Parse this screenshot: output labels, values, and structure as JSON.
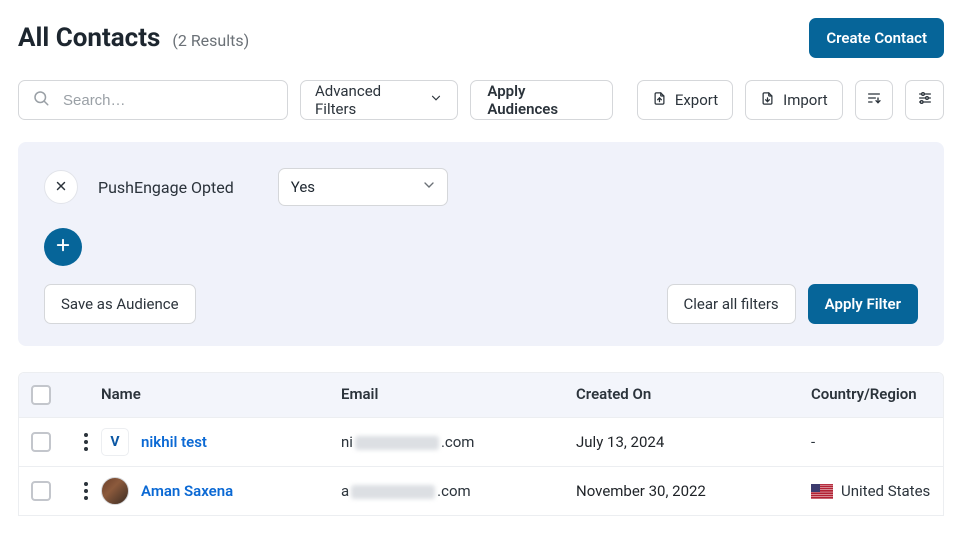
{
  "header": {
    "title": "All Contacts",
    "results_label": "(2 Results)",
    "create_button": "Create Contact"
  },
  "toolbar": {
    "search_placeholder": "Search…",
    "advanced_filters": "Advanced Filters",
    "apply_audiences": "Apply Audiences",
    "export": "Export",
    "import": "Import"
  },
  "filter_panel": {
    "field_label": "PushEngage Opted",
    "value": "Yes",
    "save_as_audience": "Save as Audience",
    "clear_all": "Clear all filters",
    "apply_filter": "Apply Filter"
  },
  "table": {
    "columns": {
      "name": "Name",
      "email": "Email",
      "created_on": "Created On",
      "country": "Country/Region"
    },
    "rows": [
      {
        "name": "nikhil test",
        "email_prefix": "ni",
        "email_suffix": ".com",
        "created_on": "July 13, 2024",
        "country": "-",
        "avatar_style": "logo"
      },
      {
        "name": "Aman Saxena",
        "email_prefix": "a",
        "email_suffix": ".com",
        "created_on": "November 30, 2022",
        "country": "United States",
        "avatar_style": "round",
        "flag": "us"
      }
    ]
  }
}
